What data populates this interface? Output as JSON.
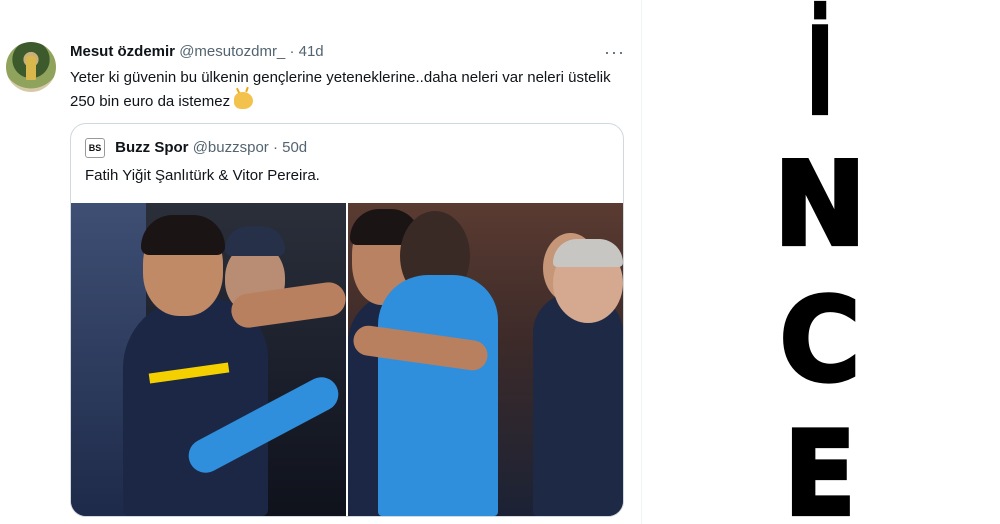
{
  "tweet": {
    "author_name": "Mesut özdemir",
    "author_handle": "@mesutozdmr_",
    "separator": "·",
    "time": "41d",
    "more_label": "···",
    "text": "Yeter ki güvenin bu ülkenin gençlerine yeteneklerine..daha neleri var neleri üstelik 250 bin euro da istemez",
    "emoji": "clapping-hands-emoji"
  },
  "quoted_tweet": {
    "logo": "BS",
    "author_name": "Buzz Spor",
    "author_handle": "@buzzspor",
    "separator": "·",
    "time": "50d",
    "text": "Fatih Yiğit Şanlıtürk & Vitor Pereira."
  },
  "side_title": {
    "letters": [
      "İ",
      "N",
      "C",
      "E"
    ]
  },
  "colors": {
    "text": "#0f1419",
    "muted": "#536471",
    "border": "#cfd9de",
    "kit_navy": "#1b2744",
    "kit_yellow": "#f4d000",
    "jacket_blue": "#2f8fdc"
  }
}
